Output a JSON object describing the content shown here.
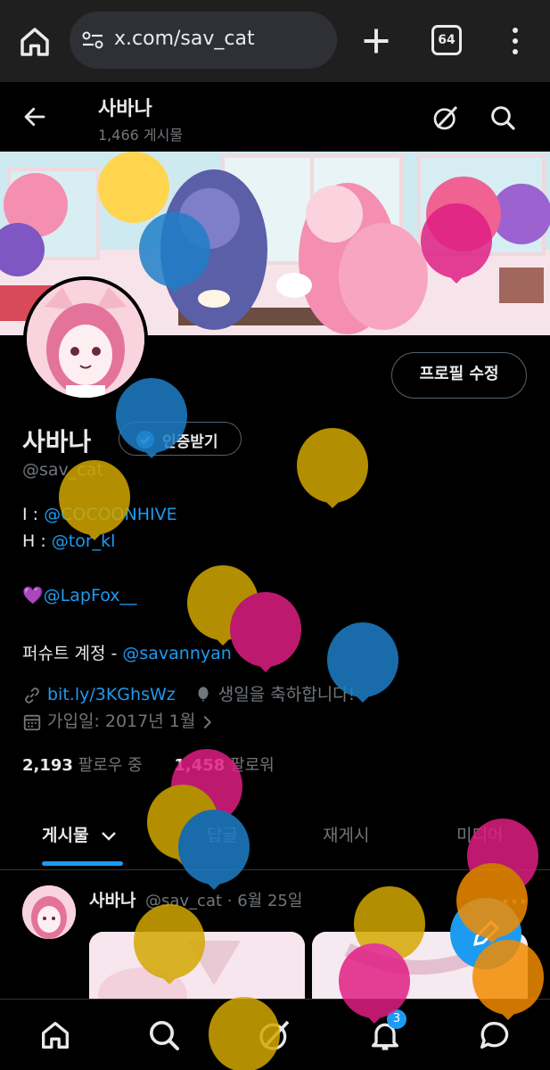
{
  "browser": {
    "url": "x.com/sav_cat",
    "tab_count": "64"
  },
  "header": {
    "name": "사바나",
    "post_count": "1,466 게시물"
  },
  "profile": {
    "edit_button": "프로필 수정",
    "display_name": "사바나",
    "verify_button": "인증받기",
    "handle": "@sav_cat",
    "bio": {
      "line1_prefix": "I : ",
      "line1_link": "@COCOONHIVE",
      "line2_prefix": "H : ",
      "line2_link": "@tor_kl",
      "line3_emoji": "💜",
      "line3_link": "@LapFox__",
      "line4_prefix": "퍼슈트 계정 - ",
      "line4_link": "@savannyan"
    },
    "website": "bit.ly/3KGhsWz",
    "birthday": "생일을 축하합니다!",
    "joined": "가입일: 2017년 1월",
    "following_count": "2,193",
    "following_label": "팔로우 중",
    "followers_count": "1,458",
    "followers_label": "팔로워"
  },
  "tabs": [
    {
      "label": "게시물"
    },
    {
      "label": "답글"
    },
    {
      "label": "재게시"
    },
    {
      "label": "미디어"
    }
  ],
  "post": {
    "name": "사바나",
    "handle_date": "@sav_cat · 6월 25일"
  },
  "notifications_badge": "3",
  "colors": {
    "accent": "#1d9bf0",
    "background": "#000000",
    "muted": "#71767b",
    "balloon_yellow": "#d4a800",
    "balloon_pink": "#e01e84",
    "balloon_blue": "#1f7fc8",
    "balloon_orange": "#f28c00"
  }
}
